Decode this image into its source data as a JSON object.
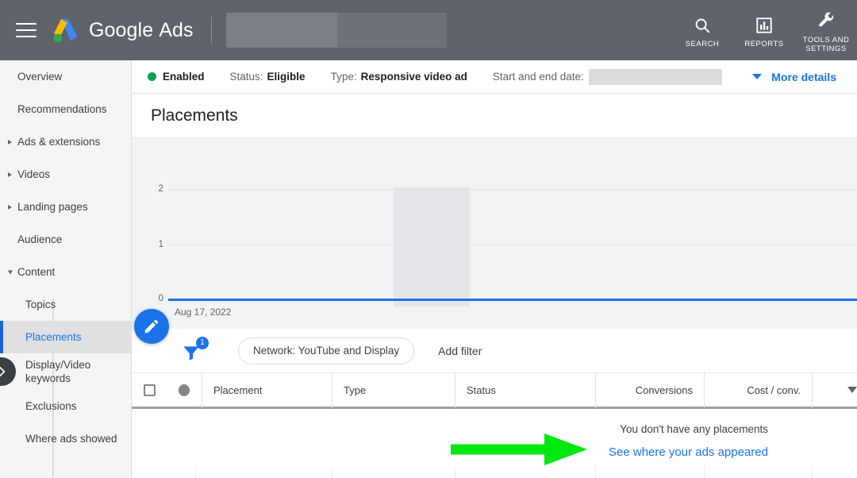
{
  "topbar": {
    "menu_icon": "hamburger-menu-icon",
    "logo_icon": "google-ads-logo-icon",
    "brand_primary": "Google",
    "brand_secondary": "Ads",
    "search": {
      "label": "SEARCH",
      "icon": "search-icon"
    },
    "reports": {
      "label": "REPORTS",
      "icon": "reports-bar-chart-icon"
    },
    "tools": {
      "label": "TOOLS AND SETTINGS",
      "label_line1": "TOOLS AND",
      "label_line2": "SETTINGS",
      "icon": "wrench-tools-icon"
    }
  },
  "sidebar": {
    "items": [
      {
        "label": "Overview",
        "expandable": false,
        "expanded": false,
        "child": false,
        "selected": false
      },
      {
        "label": "Recommendations",
        "expandable": false,
        "expanded": false,
        "child": false,
        "selected": false
      },
      {
        "label": "Ads & extensions",
        "expandable": true,
        "expanded": false,
        "child": false,
        "selected": false
      },
      {
        "label": "Videos",
        "expandable": true,
        "expanded": false,
        "child": false,
        "selected": false
      },
      {
        "label": "Landing pages",
        "expandable": true,
        "expanded": false,
        "child": false,
        "selected": false
      },
      {
        "label": "Audience",
        "expandable": false,
        "expanded": false,
        "child": false,
        "selected": false
      },
      {
        "label": "Content",
        "expandable": true,
        "expanded": true,
        "child": false,
        "selected": false
      },
      {
        "label": "Topics",
        "expandable": false,
        "expanded": false,
        "child": true,
        "selected": false
      },
      {
        "label": "Placements",
        "expandable": false,
        "expanded": false,
        "child": true,
        "selected": true
      },
      {
        "label": "Display/Video keywords",
        "expandable": false,
        "expanded": false,
        "child": true,
        "selected": false
      },
      {
        "label": "Exclusions",
        "expandable": false,
        "expanded": false,
        "child": true,
        "selected": false
      },
      {
        "label": "Where ads showed",
        "expandable": false,
        "expanded": false,
        "child": true,
        "selected": false
      }
    ],
    "expand_handle_icon": "chevron-right-icon"
  },
  "status_strip": {
    "state": "Enabled",
    "status_label": "Status:",
    "status_value": "Eligible",
    "type_label": "Type:",
    "type_value": "Responsive video ad",
    "date_label": "Start and end date:",
    "date_value": "",
    "more_details": "More details",
    "enabled_color": "#0f9d58",
    "link_color": "#1a73e8"
  },
  "page": {
    "title": "Placements"
  },
  "fab": {
    "icon": "edit-pencil-icon",
    "color": "#1a73e8"
  },
  "chart_data": {
    "type": "line",
    "title": "",
    "xlabel": "",
    "ylabel": "",
    "x": [
      "Aug 17, 2022"
    ],
    "tick_labels_x": [
      "Aug 17, 2022"
    ],
    "tick_labels_y": [
      "0",
      "1",
      "2"
    ],
    "ylim": [
      0,
      2
    ],
    "series": [
      {
        "name": "Placements",
        "values": [
          0
        ],
        "color": "#1a73e8"
      }
    ],
    "grid": true,
    "legend": "none",
    "line_color": "#1a73e8",
    "background": "#f1f3f4",
    "hover_band": true
  },
  "filter_bar": {
    "filter_icon": "filter-funnel-icon",
    "filter_count": "1",
    "chip_label": "Network: YouTube and Display",
    "add_filter": "Add filter"
  },
  "table": {
    "columns": [
      {
        "label": "Placement",
        "align": "left"
      },
      {
        "label": "Type",
        "align": "left"
      },
      {
        "label": "Status",
        "align": "left"
      },
      {
        "label": "Conversions",
        "align": "right"
      },
      {
        "label": "Cost / conv.",
        "align": "right"
      }
    ],
    "select_all_icon": "checkbox-unchecked-icon",
    "status_circle_icon": "status-circle-icon",
    "sort_icon": "sort-descending-caret-icon",
    "empty_message": "You don't have any placements",
    "empty_link": "See where your ads appeared"
  },
  "annotation": {
    "arrow_icon": "green-right-arrow-annotation",
    "color": "#00e810"
  }
}
